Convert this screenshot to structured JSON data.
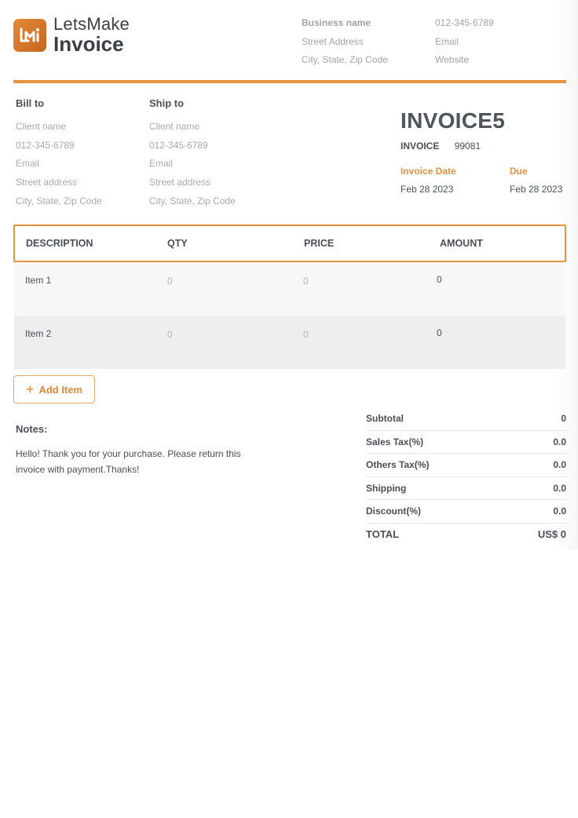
{
  "brand": {
    "name_top": "LetsMake",
    "name_bottom": "Invoice",
    "accent": "#e39340"
  },
  "business": {
    "name": "Business name",
    "address": "Street Address",
    "city": "City, State, Zip Code",
    "phone": "012-345-6789",
    "email": "Email",
    "website": "Website"
  },
  "bill_to": {
    "heading": "Bill to",
    "client": "Client name",
    "phone": "012-345-6789",
    "email": "Email",
    "street": "Street address",
    "city": "City, State, Zip Code"
  },
  "ship_to": {
    "heading": "Ship to",
    "client": "Client name",
    "phone": "012-345-6789",
    "email": "Email",
    "street": "Street address",
    "city": "City, State, Zip Code"
  },
  "invoice": {
    "title": "INVOICE5",
    "number_label": "INVOICE",
    "number": "99081",
    "date_label": "Invoice Date",
    "date": "Feb 28 2023",
    "due_label": "Due",
    "due": "Feb 28 2023"
  },
  "table": {
    "headers": [
      "DESCRIPTION",
      "QTY",
      "PRICE",
      "AMOUNT"
    ],
    "rows": [
      {
        "description": "Item 1",
        "qty": "0",
        "price": "0",
        "amount": "0"
      },
      {
        "description": "Item 2",
        "qty": "0",
        "price": "0",
        "amount": "0"
      }
    ]
  },
  "add_item": {
    "icon": "plus-icon",
    "label": "Add Item"
  },
  "notes": {
    "heading": "Notes:",
    "text": "Hello! Thank you for your purchase. Please return this invoice with payment.Thanks!"
  },
  "totals": {
    "subtotal_label": "Subtotal",
    "subtotal": "0",
    "sales_tax_label": "Sales Tax(%)",
    "sales_tax": "0.0",
    "others_tax_label": "Others Tax(%)",
    "others_tax": "0.0",
    "shipping_label": "Shipping",
    "shipping": "0.0",
    "discount_label": "Discount(%)",
    "discount": "0.0",
    "total_label": "TOTAL",
    "total": "US$ 0"
  }
}
